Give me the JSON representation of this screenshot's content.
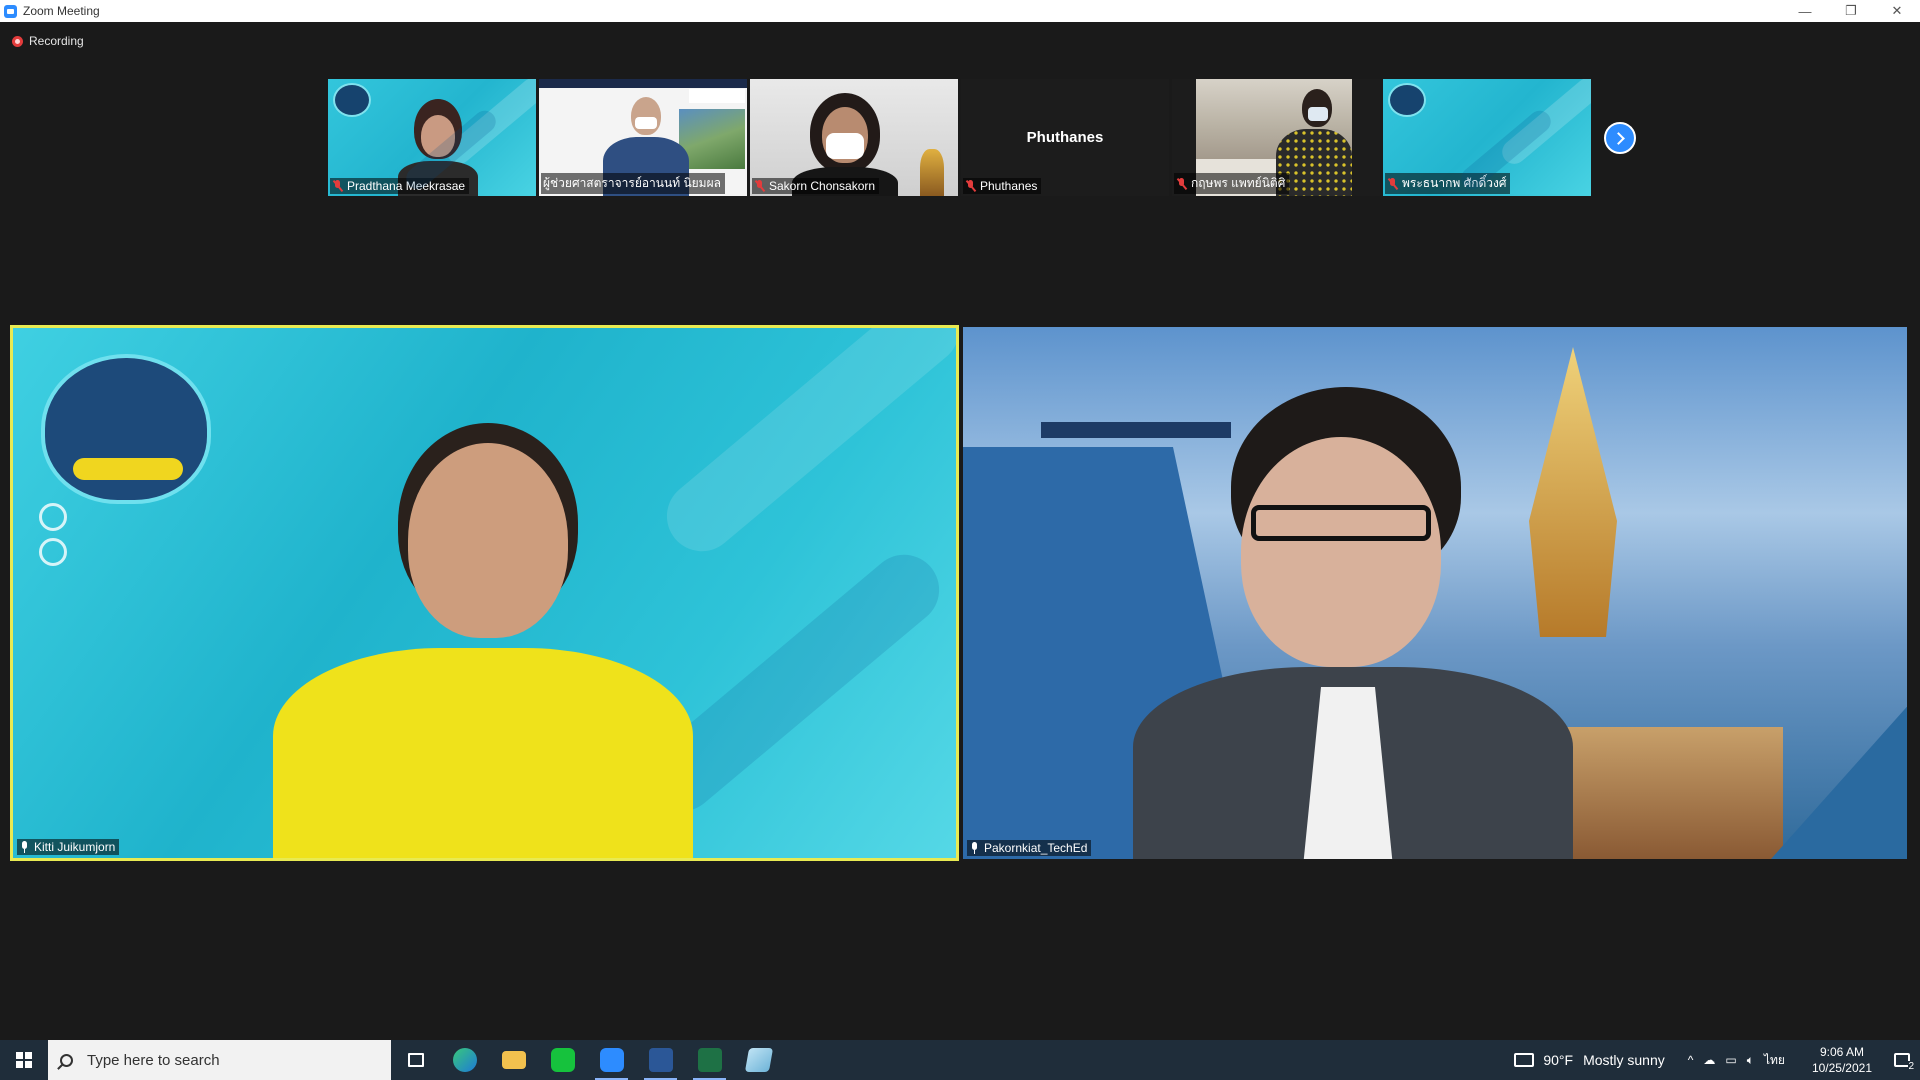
{
  "window": {
    "title": "Zoom Meeting",
    "controls": {
      "minimize": "—",
      "restore": "❐",
      "close": "✕"
    }
  },
  "meeting": {
    "recording_label": "Recording",
    "thumbnails": [
      {
        "name": "Pradthana Meekrasae",
        "muted": true
      },
      {
        "name": "ผู้ช่วยศาสตราจารย์อานนท์ นิยมผล",
        "muted": true
      },
      {
        "name": "Sakorn Chonsakorn",
        "muted": true
      },
      {
        "name": "Phuthanes",
        "muted": true,
        "display_name": "Phuthanes"
      },
      {
        "name": "กฤษพร แพทย์นิติศิ",
        "muted": true
      },
      {
        "name": "พระธนากพ ศักดิ์วงศ์",
        "muted": true
      }
    ],
    "next_page_icon": "chevron-right-icon",
    "main_videos": [
      {
        "name": "Kitti Juikumjorn",
        "muted": false,
        "active_speaker": true
      },
      {
        "name": "Pakornkiat_TechEd",
        "muted": false,
        "active_speaker": false
      }
    ]
  },
  "taskbar": {
    "search_placeholder": "Type here to search",
    "apps": [
      "task-view-icon",
      "edge-icon",
      "file-explorer-icon",
      "line-icon",
      "zoom-icon",
      "word-icon",
      "excel-icon",
      "notepad-icon"
    ],
    "weather": {
      "temp": "90°F",
      "condition": "Mostly sunny"
    },
    "language": "ไทย",
    "time": "9:06 AM",
    "date": "10/25/2021",
    "notification_count": "2"
  },
  "colors": {
    "active_speaker_border": "#e8ea52",
    "zoom_blue": "#2d8cff",
    "muted_red": "#e33c3c",
    "taskbar": "#1f2d3a"
  }
}
